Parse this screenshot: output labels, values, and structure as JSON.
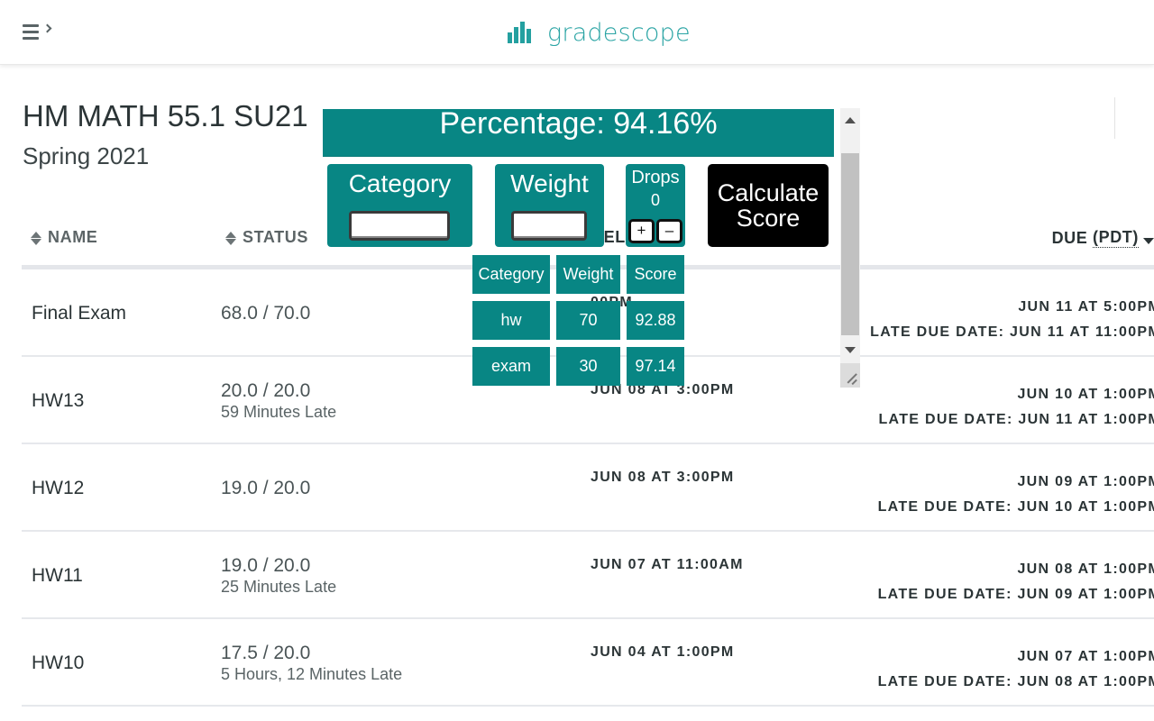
{
  "app": {
    "brand": "gradescope",
    "brand_color": "#2aa4a4",
    "menu_icon": "hamburger-expand-icon"
  },
  "course": {
    "title": "HM MATH 55.1 SU21",
    "term": "Spring 2021"
  },
  "table": {
    "columns": {
      "name": "NAME",
      "status": "STATUS",
      "released": "REL",
      "due": "DUE",
      "due_tz": "(PDT)"
    },
    "rows": [
      {
        "name": "Final Exam",
        "score": "68.0 / 70.0",
        "late": "",
        "released": "00PM",
        "due": "JUN 11 AT 5:00PM",
        "late_due": "LATE DUE DATE: JUN 11 AT 11:00PM"
      },
      {
        "name": "HW13",
        "score": "20.0 / 20.0",
        "late": "59 Minutes Late",
        "released": "JUN 08 AT 3:00PM",
        "due": "JUN 10 AT 1:00PM",
        "late_due": "LATE DUE DATE: JUN 11 AT 1:00PM"
      },
      {
        "name": "HW12",
        "score": "19.0 / 20.0",
        "late": "",
        "released": "JUN 08 AT 3:00PM",
        "due": "JUN 09 AT 1:00PM",
        "late_due": "LATE DUE DATE: JUN 10 AT 1:00PM"
      },
      {
        "name": "HW11",
        "score": "19.0 / 20.0",
        "late": "25 Minutes Late",
        "released": "JUN 07 AT 11:00AM",
        "due": "JUN 08 AT 1:00PM",
        "late_due": "LATE DUE DATE: JUN 09 AT 1:00PM"
      },
      {
        "name": "HW10",
        "score": "17.5 / 20.0",
        "late": "5 Hours, 12 Minutes Late",
        "released": "JUN 04 AT 1:00PM",
        "due": "JUN 07 AT 1:00PM",
        "late_due": "LATE DUE DATE: JUN 08 AT 1:00PM"
      }
    ]
  },
  "calculator": {
    "percentage_text": "Percentage: 94.16%",
    "percentage_value": 94.16,
    "accent_color": "#088684",
    "category_label": "Category",
    "category_value": "",
    "weight_label": "Weight",
    "weight_value": "",
    "drops_label": "Drops",
    "drops_value": "0",
    "plus_label": "+",
    "minus_label": "–",
    "calculate_label_line1": "Calculate",
    "calculate_label_line2": "Score",
    "results": {
      "headers": [
        "Category",
        "Weight",
        "Score"
      ],
      "rows": [
        [
          "hw",
          "70",
          "92.88"
        ],
        [
          "exam",
          "30",
          "97.14"
        ]
      ]
    }
  }
}
